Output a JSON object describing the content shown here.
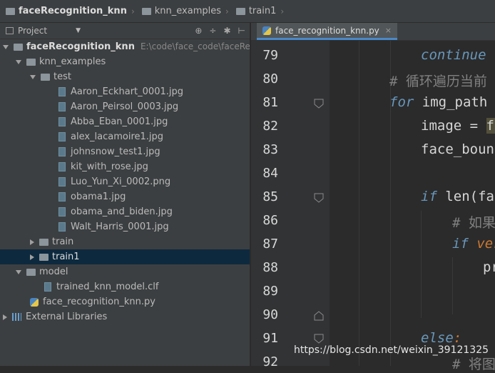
{
  "breadcrumb": [
    {
      "label": "faceRecognition_knn",
      "bold": true
    },
    {
      "label": "knn_examples",
      "bold": false
    },
    {
      "label": "train1",
      "bold": false
    }
  ],
  "project_panel": {
    "title": "Project",
    "tools": [
      "⊕",
      "÷",
      "✱",
      "⊢"
    ]
  },
  "tree": [
    {
      "label": "faceRecognition_knn",
      "path": "E:\\code\\face_code\\faceRecogn",
      "type": "root",
      "bold": true
    },
    {
      "label": "knn_examples",
      "type": "folder"
    },
    {
      "label": "test",
      "type": "folder"
    },
    {
      "label": "Aaron_Eckhart_0001.jpg",
      "type": "file"
    },
    {
      "label": "Aaron_Peirsol_0003.jpg",
      "type": "file"
    },
    {
      "label": "Abba_Eban_0001.jpg",
      "type": "file"
    },
    {
      "label": "alex_lacamoire1.jpg",
      "type": "file"
    },
    {
      "label": "johnsnow_test1.jpg",
      "type": "file"
    },
    {
      "label": "kit_with_rose.jpg",
      "type": "file"
    },
    {
      "label": "Luo_Yun_Xi_0002.png",
      "type": "file"
    },
    {
      "label": "obama1.jpg",
      "type": "file"
    },
    {
      "label": "obama_and_biden.jpg",
      "type": "file"
    },
    {
      "label": "Walt_Harris_0001.jpg",
      "type": "file"
    },
    {
      "label": "train",
      "type": "folder"
    },
    {
      "label": "train1",
      "type": "folder",
      "selected": true
    },
    {
      "label": "model",
      "type": "folder"
    },
    {
      "label": "trained_knn_model.clf",
      "type": "file"
    },
    {
      "label": "face_recognition_knn.py",
      "type": "py"
    },
    {
      "label": "External Libraries",
      "type": "lib"
    }
  ],
  "editor": {
    "tab_label": "face_recognition_knn.py",
    "close_glyph": "×",
    "line_numbers": [
      "79",
      "80",
      "81",
      "82",
      "83",
      "84",
      "85",
      "86",
      "87",
      "88",
      "89",
      "90",
      "91",
      "92"
    ],
    "lines": {
      "l79": "continue",
      "l80": "# 循环遍历当前",
      "l81_kw": "for",
      "l81_rest": " img_path i",
      "l82_a": "image = ",
      "l82_b": "fa",
      "l83": "face_bound",
      "l85_kw": "if",
      "l85_rest": " len(fac",
      "l86": "# 如果",
      "l87_kw": "if",
      "l87_rest": " ver",
      "l88": "pri",
      "l91_kw": "else",
      "l91_rest": ":",
      "l92": "# 将图"
    }
  },
  "watermark": "https://blog.csdn.net/weixin_39121325"
}
